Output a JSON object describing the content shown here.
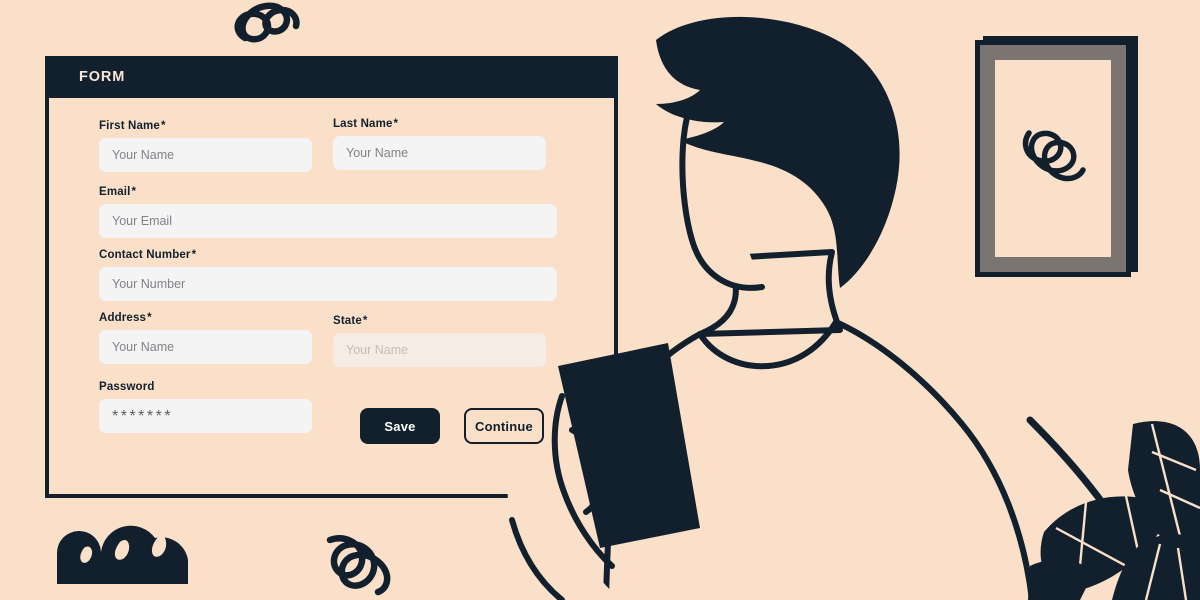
{
  "theme": {
    "background": "#fae0c8",
    "ink": "#12202e",
    "input_background": "#f4f4f5",
    "placeholder": "#828288",
    "header_text": "#f7e7d6",
    "frame_mat": "#7b7572",
    "button_text_light": "#ffffff"
  },
  "form": {
    "header_title": "FORM",
    "fields": [
      {
        "id": "first-name",
        "label": "First Name",
        "required_mark": "*",
        "placeholder": "Your Name",
        "value": "",
        "type": "text"
      },
      {
        "id": "last-name",
        "label": "Last Name",
        "required_mark": "*",
        "placeholder": "Your Name",
        "value": "",
        "type": "text"
      },
      {
        "id": "email",
        "label": "Email",
        "required_mark": "*",
        "placeholder": "Your Email",
        "value": "",
        "type": "email"
      },
      {
        "id": "contact-number",
        "label": "Contact  Number",
        "required_mark": "*",
        "placeholder": "Your Number",
        "value": "",
        "type": "tel"
      },
      {
        "id": "address",
        "label": "Address",
        "required_mark": "*",
        "placeholder": "Your Name",
        "value": "",
        "type": "text"
      },
      {
        "id": "state",
        "label": "State",
        "required_mark": "*",
        "placeholder": "Your Name",
        "value": "",
        "type": "text"
      },
      {
        "id": "password",
        "label": "Password",
        "required_mark": "",
        "placeholder": "",
        "value": "*******",
        "type": "password"
      }
    ],
    "buttons": {
      "save": "Save",
      "continue": "Continue"
    }
  },
  "decor": {
    "frame": {
      "name": "wall-picture-frame",
      "artwork": "loop-squiggle-doodle"
    },
    "person": {
      "name": "person-holding-phone-illustration"
    },
    "bush": {
      "name": "bush-shrub-silhouette"
    },
    "squiggle_top": {
      "name": "loop-squiggle-doodle"
    },
    "squiggle_bottom": {
      "name": "loop-squiggle-doodle"
    },
    "plant": {
      "name": "leafy-plant-silhouette"
    }
  }
}
